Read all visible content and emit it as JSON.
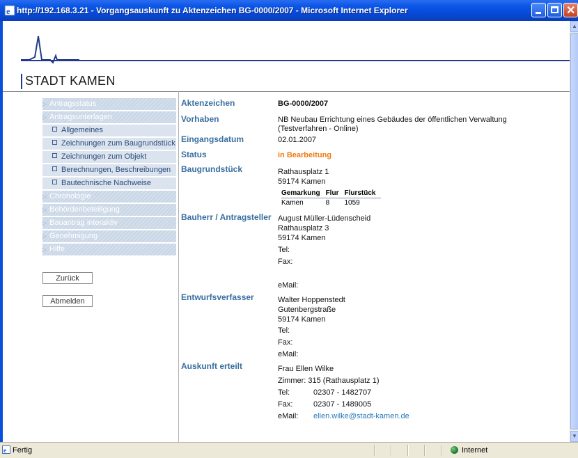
{
  "window": {
    "title": "http://192.168.3.21 - Vorgangsauskunft zu Aktenzeichen BG-0000/2007 - Microsoft Internet Explorer",
    "icon": "ie-icon"
  },
  "header": {
    "logo_text": "STADT KAMEN"
  },
  "sidebar": {
    "items": [
      {
        "label": "Antragsstatus",
        "type": "main"
      },
      {
        "label": "Antragsunterlagen",
        "type": "main"
      },
      {
        "label": "Allgemeines",
        "type": "sub"
      },
      {
        "label": "Zeichnungen zum Baugrundstück",
        "type": "sub"
      },
      {
        "label": "Zeichnungen zum Objekt",
        "type": "sub"
      },
      {
        "label": "Berechnungen, Beschreibungen",
        "type": "sub"
      },
      {
        "label": "Bautechnische Nachweise",
        "type": "sub"
      },
      {
        "label": "Chronologie",
        "type": "main"
      },
      {
        "label": "Behördenbeteiligung",
        "type": "main"
      },
      {
        "label": "Bauantrag interaktiv",
        "type": "main"
      },
      {
        "label": "Genehmigung",
        "type": "main"
      },
      {
        "label": "Hilfe",
        "type": "main"
      }
    ],
    "back_button": "Zurück",
    "logout_button": "Abmelden"
  },
  "details": {
    "aktenzeichen_label": "Aktenzeichen",
    "aktenzeichen_value": "BG-0000/2007",
    "vorhaben_label": "Vorhaben",
    "vorhaben_line1": "NB Neubau Errichtung eines Gebäudes der öffentlichen Verwaltung",
    "vorhaben_line2": "(Testverfahren - Online)",
    "eingangsdatum_label": "Eingangsdatum",
    "eingangsdatum_value": "02.01.2007",
    "status_label": "Status",
    "status_value": "in Bearbeitung",
    "baugrundstueck_label": "Baugrundstück",
    "baugrundstueck_street": "Rathausplatz 1",
    "baugrundstueck_city": "59174 Kamen",
    "gemarkung_headers": [
      "Gemarkung",
      "Flur",
      "Flurstück"
    ],
    "gemarkung_row": [
      "Kamen",
      "8",
      "1059"
    ],
    "bauherr_label": "Bauherr / Antragsteller",
    "bauherr_name": "August Müller-Lüdenscheid",
    "bauherr_street": "Rathausplatz 3",
    "bauherr_city": "59174 Kamen",
    "tel_label": "Tel:",
    "fax_label": "Fax:",
    "email_label": "eMail:",
    "entwurf_label": "Entwurfsverfasser",
    "entwurf_name": "Walter Hoppenstedt",
    "entwurf_street": "Gutenbergstraße",
    "entwurf_city": "59174 Kamen",
    "auskunft_label": "Auskunft erteilt",
    "auskunft_name": "Frau Ellen Wilke",
    "auskunft_room": "Zimmer: 315 (Rathausplatz 1)",
    "auskunft_tel": "02307 - 1482707",
    "auskunft_fax": "02307 - 1489005",
    "auskunft_email": "ellen.wilke@stadt-kamen.de"
  },
  "statusbar": {
    "text": "Fertig",
    "zone": "Internet"
  },
  "colors": {
    "label_blue": "#3a6fa0",
    "status_orange": "#f07a10",
    "titlebar_blue": "#0a56e6"
  }
}
